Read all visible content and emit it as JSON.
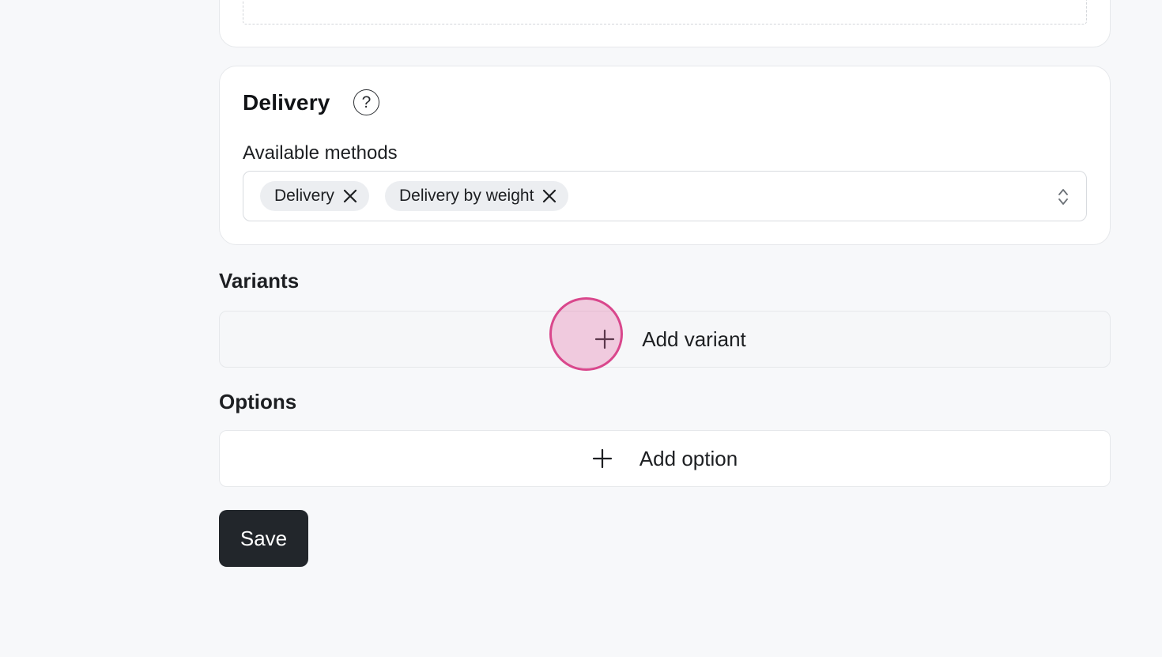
{
  "delivery": {
    "title": "Delivery",
    "help_icon": "question-mark-icon",
    "methods_label": "Available methods",
    "selected_methods": [
      "Delivery",
      "Delivery by weight"
    ]
  },
  "variants": {
    "heading": "Variants",
    "add_label": "Add variant"
  },
  "options": {
    "heading": "Options",
    "add_label": "Add option"
  },
  "actions": {
    "save_label": "Save"
  },
  "colors": {
    "background": "#f7f8fa",
    "primary_button": "#22262b",
    "click_marker": "#d9478c"
  }
}
